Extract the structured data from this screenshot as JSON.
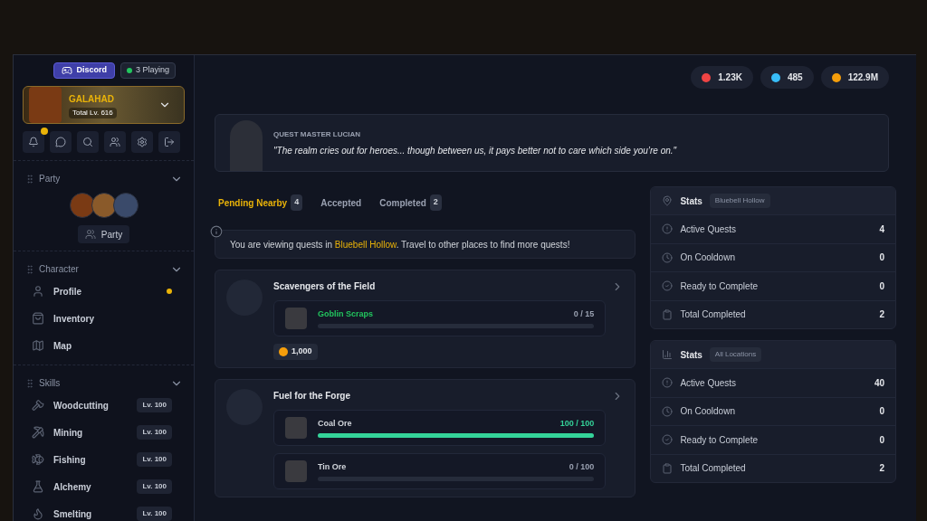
{
  "sidebar": {
    "discord": {
      "label": "Discord"
    },
    "status": {
      "label": "3 Playing",
      "online": true
    },
    "hero": {
      "name": "GALAHAD",
      "level": "Total Lv. 616"
    },
    "toolbar": [
      {
        "kind": "bell",
        "badge": true
      },
      {
        "kind": "chat",
        "badge": false
      },
      {
        "kind": "search",
        "badge": false
      },
      {
        "kind": "users",
        "badge": false
      },
      {
        "kind": "settings",
        "badge": false
      },
      {
        "kind": "logout",
        "badge": false
      }
    ],
    "party": {
      "title": "Party",
      "expanded": true,
      "button": "Party"
    },
    "character": {
      "title": "Character",
      "expanded": true,
      "items": [
        {
          "label": "Profile",
          "badge": true
        },
        {
          "label": "Inventory",
          "badge": false
        },
        {
          "label": "Map",
          "badge": false
        }
      ]
    },
    "skills": {
      "title": "Skills",
      "expanded": true,
      "items": [
        {
          "label": "Woodcutting",
          "level": "Lv. 100"
        },
        {
          "label": "Mining",
          "level": "Lv. 100"
        },
        {
          "label": "Fishing",
          "level": "Lv. 100"
        },
        {
          "label": "Alchemy",
          "level": "Lv. 100"
        },
        {
          "label": "Smelting",
          "level": "Lv. 100"
        }
      ]
    }
  },
  "currencies": [
    {
      "value": "1.23K"
    },
    {
      "value": "485"
    },
    {
      "value": "122.9M"
    }
  ],
  "quest_master": {
    "name": "QUEST MASTER LUCIAN",
    "quote": "\"The realm cries out for heroes... though between us, it pays better not to care which side you’re on.\""
  },
  "tabs": [
    {
      "label": "Pending Nearby",
      "count": "4",
      "selected": true
    },
    {
      "label": "Accepted",
      "selected": false
    },
    {
      "label": "Completed",
      "count": "2",
      "selected": false
    }
  ],
  "info": "You are viewing quests in **Bluebell Hollow**. Travel to other places to find more quests!",
  "quests": [
    {
      "title": "Scavengers of the Field",
      "objectives": [
        {
          "name": "Goblin Scraps",
          "color": "#22c55e",
          "progress": "0 / 15",
          "level": 0,
          "complete": false
        }
      ],
      "reward": "1,000"
    },
    {
      "title": "Fuel for the Forge",
      "objectives": [
        {
          "name": "Coal Ore",
          "color": "#d1d5db",
          "progress": "100 / 100",
          "level": 1,
          "complete": true
        },
        {
          "name": "Tin Ore",
          "color": "#d1d5db",
          "progress": "0 / 100",
          "level": 0,
          "complete": false
        }
      ]
    }
  ],
  "stats": [
    {
      "kind": "location",
      "title": "Stats",
      "tag": "Bluebell Hollow",
      "rows": [
        {
          "label": "Active Quests",
          "value": "4"
        },
        {
          "label": "On Cooldown",
          "value": "0"
        },
        {
          "label": "Ready to Complete",
          "value": "0"
        },
        {
          "label": "Total Completed",
          "value": "2"
        }
      ]
    },
    {
      "kind": "global",
      "title": "Stats",
      "tag": "All Locations",
      "rows": [
        {
          "label": "Active Quests",
          "value": "40"
        },
        {
          "label": "On Cooldown",
          "value": "0"
        },
        {
          "label": "Ready to Complete",
          "value": "0"
        },
        {
          "label": "Total Completed",
          "value": "2"
        }
      ]
    }
  ]
}
